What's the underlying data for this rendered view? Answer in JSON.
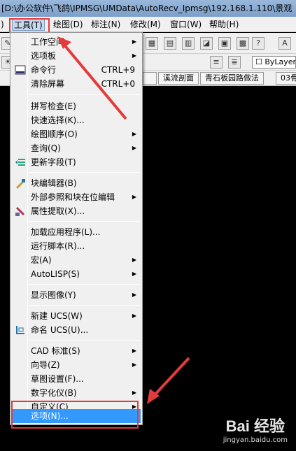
{
  "window": {
    "title": "[D:\\办公软件\\飞鸽\\IPMSG\\UMData\\AutoRecv_Ipmsg\\192.168.1.110\\景观"
  },
  "menubar": {
    "items": [
      {
        "label": ")"
      },
      {
        "label": "工具(T)"
      },
      {
        "label": "绘图(D)"
      },
      {
        "label": "标注(N)"
      },
      {
        "label": "修改(M)"
      },
      {
        "label": "窗口(W)"
      },
      {
        "label": "帮助(H)"
      }
    ]
  },
  "toolbar": {
    "layer_label": "ByLayer",
    "tabs": [
      "溪流剖面",
      "青石板园路做法",
      "03骨"
    ]
  },
  "menu": {
    "items": [
      {
        "label": "工作空间",
        "arrow": "▶"
      },
      {
        "label": "选项板",
        "arrow": "▶"
      },
      {
        "label": "命令行",
        "shortcut": "CTRL+9"
      },
      {
        "label": "清除屏幕",
        "shortcut": "CTRL+0"
      },
      {
        "label": "拼写检查(E)"
      },
      {
        "label": "快速选择(K)..."
      },
      {
        "label": "绘图顺序(O)",
        "arrow": "▶"
      },
      {
        "label": "查询(Q)",
        "arrow": "▶"
      },
      {
        "label": "更新字段(T)"
      },
      {
        "label": "块编辑器(B)"
      },
      {
        "label": "外部参照和块在位编辑",
        "arrow": "▶"
      },
      {
        "label": "属性提取(X)..."
      },
      {
        "label": "加载应用程序(L)..."
      },
      {
        "label": "运行脚本(R)..."
      },
      {
        "label": "宏(A)",
        "arrow": "▶"
      },
      {
        "label": "AutoLISP(S)",
        "arrow": "▶"
      },
      {
        "label": "显示图像(Y)",
        "arrow": "▶"
      },
      {
        "label": "新建 UCS(W)",
        "arrow": "▶"
      },
      {
        "label": "命名 UCS(U)..."
      },
      {
        "label": "CAD 标准(S)",
        "arrow": "▶"
      },
      {
        "label": "向导(Z)",
        "arrow": "▶"
      },
      {
        "label": "草图设置(F)..."
      },
      {
        "label": "数字化仪(B)",
        "arrow": "▶"
      },
      {
        "label": "自定义(C)",
        "arrow": "▶"
      },
      {
        "label": "选项(N)..."
      }
    ]
  },
  "watermark": {
    "logo": "Bai 经验",
    "url": "jingyan.baidu.com"
  }
}
